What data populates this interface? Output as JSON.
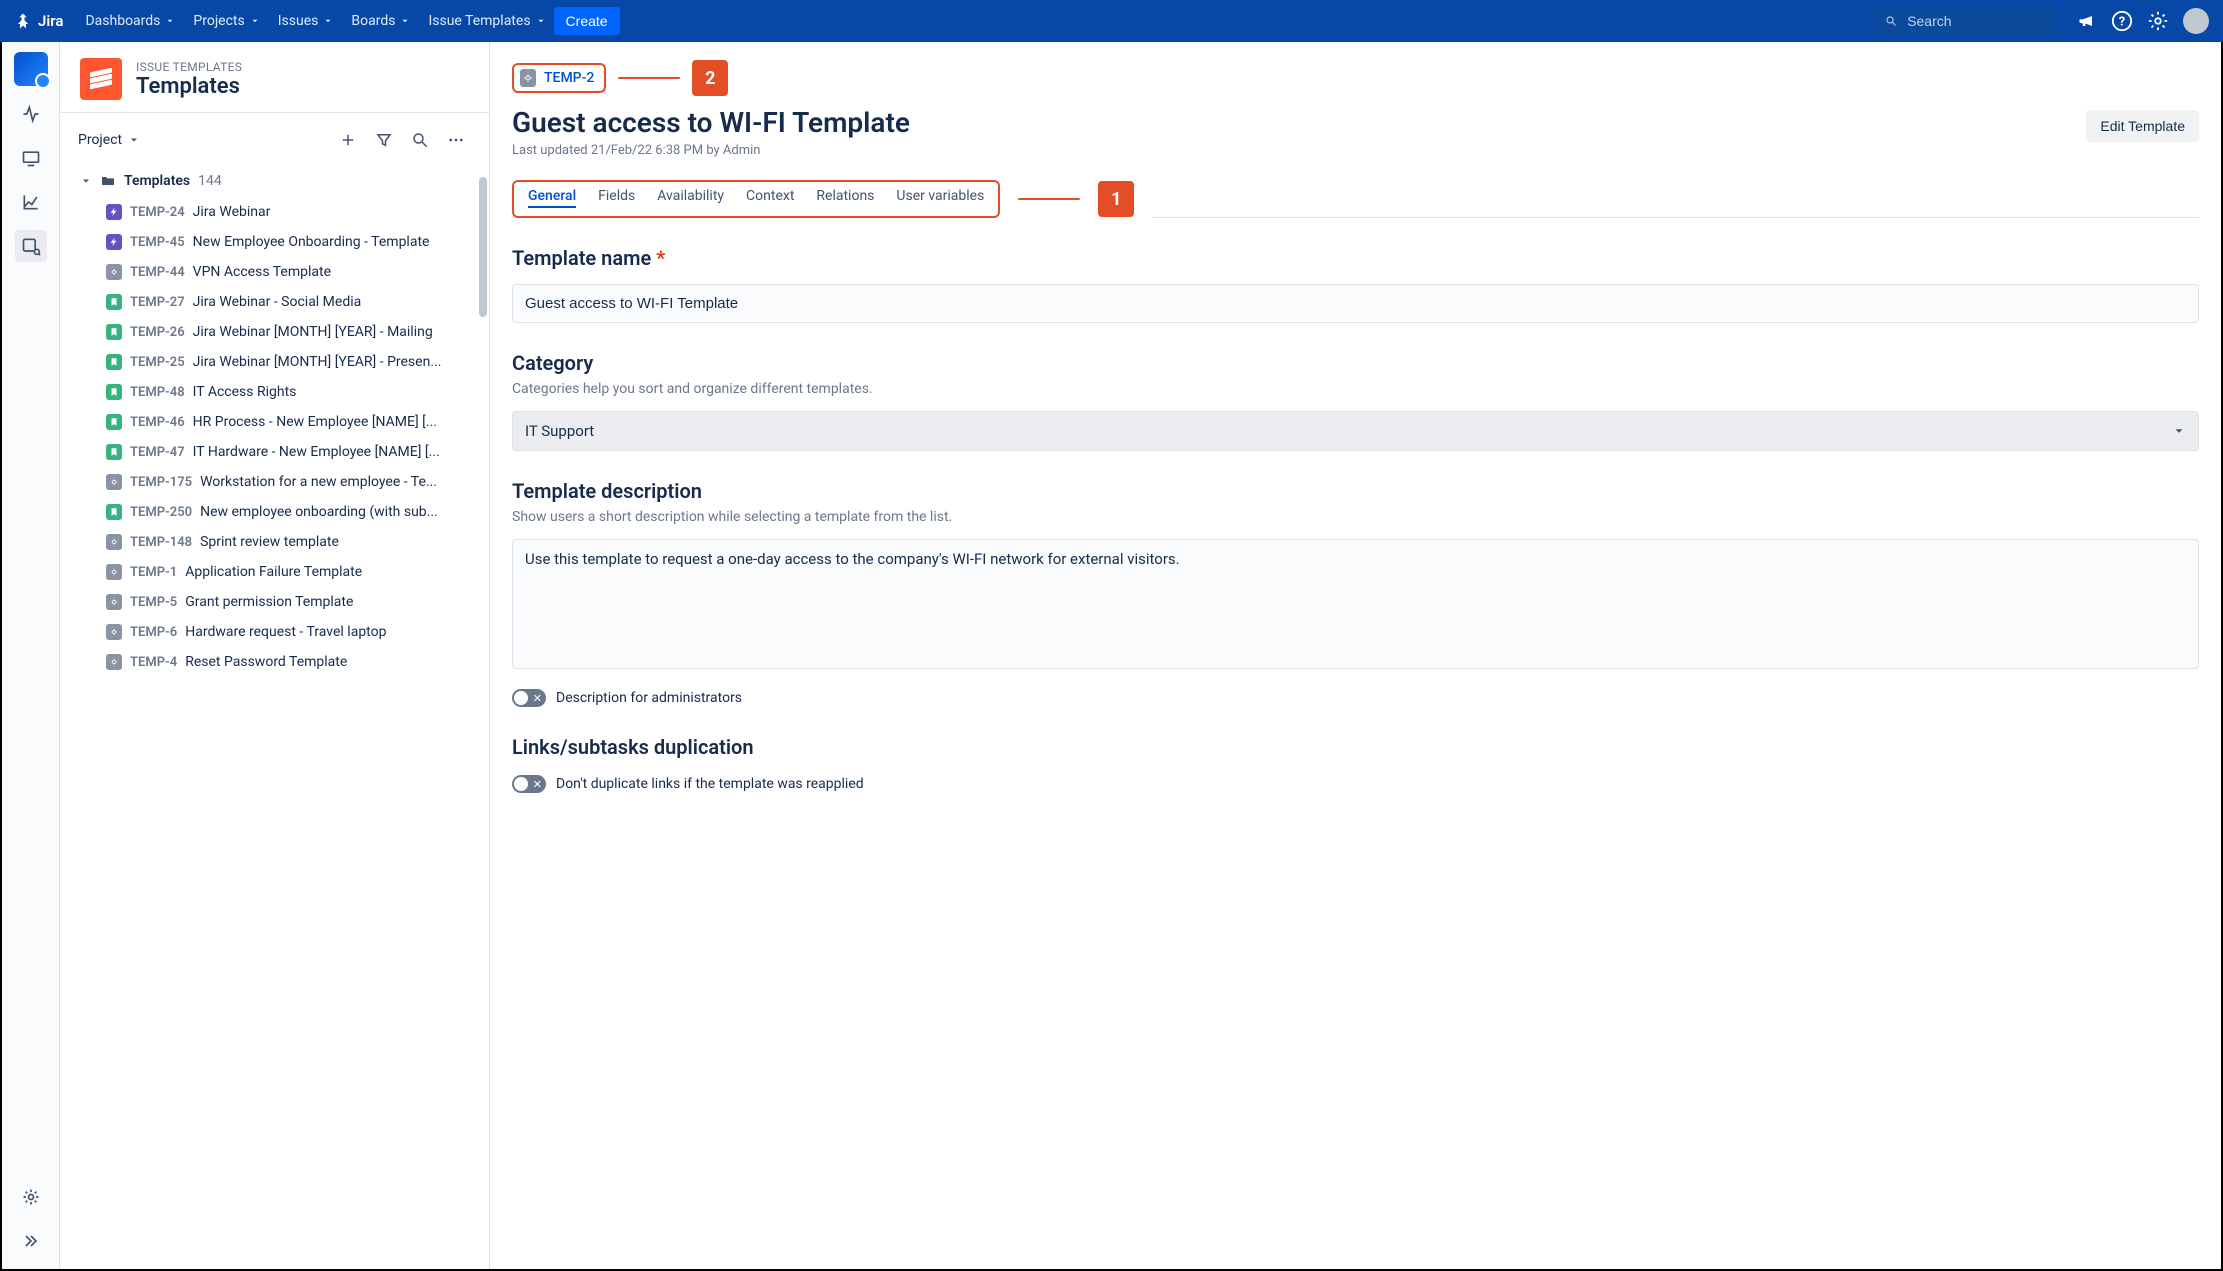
{
  "topnav": {
    "product": "Jira",
    "links": [
      "Dashboards",
      "Projects",
      "Issues",
      "Boards",
      "Issue Templates"
    ],
    "create": "Create",
    "search_placeholder": "Search"
  },
  "leftpanel": {
    "breadcrumb": "ISSUE TEMPLATES",
    "title": "Templates",
    "project_label": "Project",
    "tree_title": "Templates",
    "tree_count": "144",
    "items": [
      {
        "icon": "bolt",
        "key": "TEMP-24",
        "name": "Jira Webinar"
      },
      {
        "icon": "bolt",
        "key": "TEMP-45",
        "name": "New Employee Onboarding - Template"
      },
      {
        "icon": "gear",
        "key": "TEMP-44",
        "name": "VPN Access Template"
      },
      {
        "icon": "bm",
        "key": "TEMP-27",
        "name": "Jira Webinar - Social Media"
      },
      {
        "icon": "bm",
        "key": "TEMP-26",
        "name": "Jira Webinar [MONTH] [YEAR] - Mailing"
      },
      {
        "icon": "bm",
        "key": "TEMP-25",
        "name": "Jira Webinar [MONTH] [YEAR] - Presen..."
      },
      {
        "icon": "bm",
        "key": "TEMP-48",
        "name": "IT Access Rights"
      },
      {
        "icon": "bm",
        "key": "TEMP-46",
        "name": "HR Process - New Employee [NAME] [..."
      },
      {
        "icon": "bm",
        "key": "TEMP-47",
        "name": "IT Hardware - New Employee [NAME] [..."
      },
      {
        "icon": "gear",
        "key": "TEMP-175",
        "name": "Workstation for a new employee - Te..."
      },
      {
        "icon": "bm",
        "key": "TEMP-250",
        "name": "New employee onboarding (with sub..."
      },
      {
        "icon": "gear",
        "key": "TEMP-148",
        "name": "Sprint review template"
      },
      {
        "icon": "gear",
        "key": "TEMP-1",
        "name": "Application Failure Template"
      },
      {
        "icon": "gear",
        "key": "TEMP-5",
        "name": "Grant permission Template"
      },
      {
        "icon": "gear",
        "key": "TEMP-6",
        "name": "Hardware request - Travel laptop"
      },
      {
        "icon": "gear",
        "key": "TEMP-4",
        "name": "Reset Password Template"
      }
    ]
  },
  "main": {
    "issue_key": "TEMP-2",
    "title": "Guest access to WI-FI Template",
    "meta": "Last updated 21/Feb/22 6:38 PM by Admin",
    "edit_btn": "Edit Template",
    "tabs": [
      "General",
      "Fields",
      "Availability",
      "Context",
      "Relations",
      "User variables"
    ],
    "active_tab": 0,
    "annot_tabs": "1",
    "annot_key": "2",
    "sections": {
      "name_label": "Template name",
      "name_value": "Guest access to WI-FI Template",
      "category_label": "Category",
      "category_help": "Categories help you sort and organize different templates.",
      "category_value": "IT Support",
      "desc_label": "Template description",
      "desc_help": "Show users a short description while selecting a template from the list.",
      "desc_value": "Use this template to request a one-day access to the company's WI-FI network for external visitors.",
      "desc_admin_toggle": "Description for administrators",
      "dup_label": "Links/subtasks duplication",
      "dup_toggle": "Don't duplicate links if the template was reapplied"
    }
  }
}
